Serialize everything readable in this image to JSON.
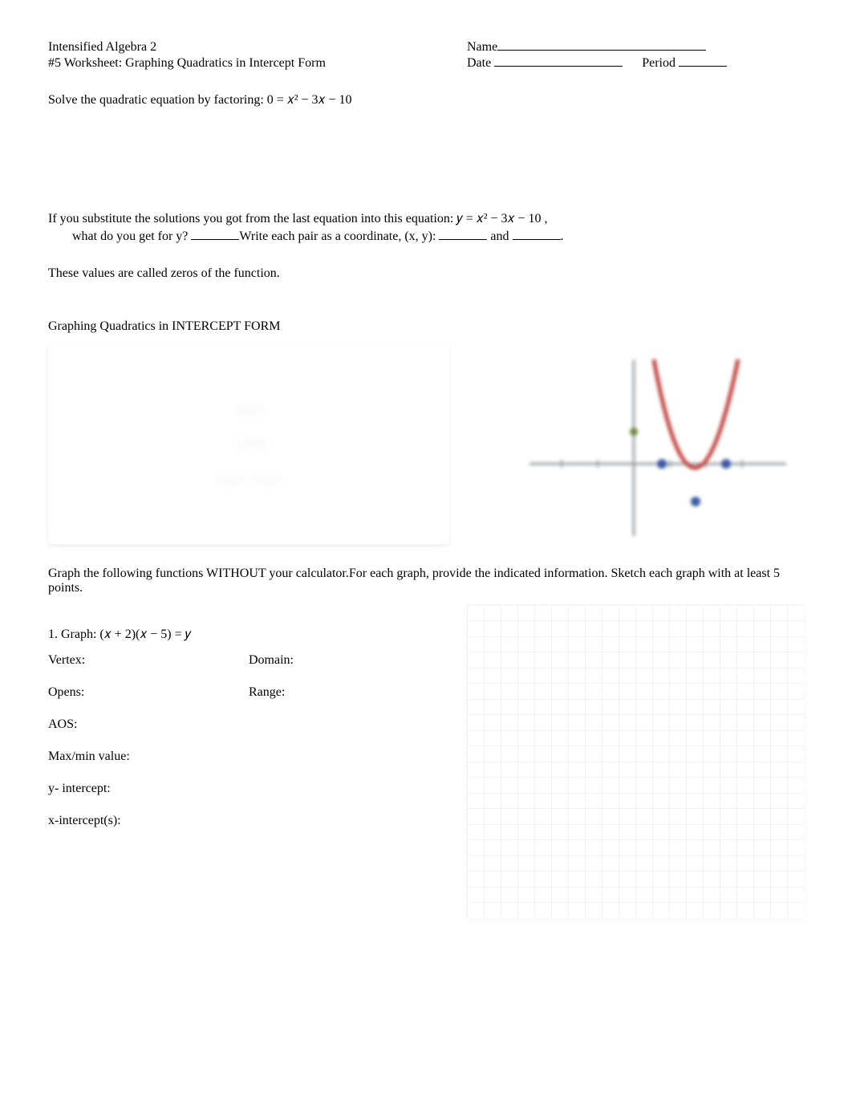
{
  "header": {
    "course": "Intensified Algebra 2",
    "worksheet_title": "#5 Worksheet:  Graphing Quadratics in Intercept Form",
    "name_label": "Name",
    "date_label": "Date",
    "period_label": "Period"
  },
  "intro": {
    "solve_prompt": "Solve the quadratic equation by factoring:  0 = 𝑥² − 3𝑥 − 10",
    "substitute_line": "If you substitute the solutions you got from the last equation into this equation:    𝑦 = 𝑥² − 3𝑥 − 10 ,",
    "what_get_prefix": "what do you get for y? ",
    "write_pair_text": "Write each pair as a coordinate, (x, y):  ",
    "and_text": " and ",
    "period": ".",
    "zeros_line": "These values are called zeros of the function."
  },
  "section_heading": "Graphing Quadratics in INTERCEPT FORM",
  "instructions": "Graph the following functions WITHOUT your calculator.For each graph, provide the indicated information.   Sketch each graph with at least 5 points.",
  "q1": {
    "prompt": "1.  Graph:   (𝑥 + 2)(𝑥 − 5) = 𝑦",
    "labels": {
      "vertex": "Vertex:",
      "domain": "Domain:",
      "opens": "Opens:",
      "range": "Range:",
      "aos": "AOS:",
      "maxmin": "Max/min value:",
      "yint": "y- intercept:",
      "xint": "x-intercept(s):"
    }
  }
}
